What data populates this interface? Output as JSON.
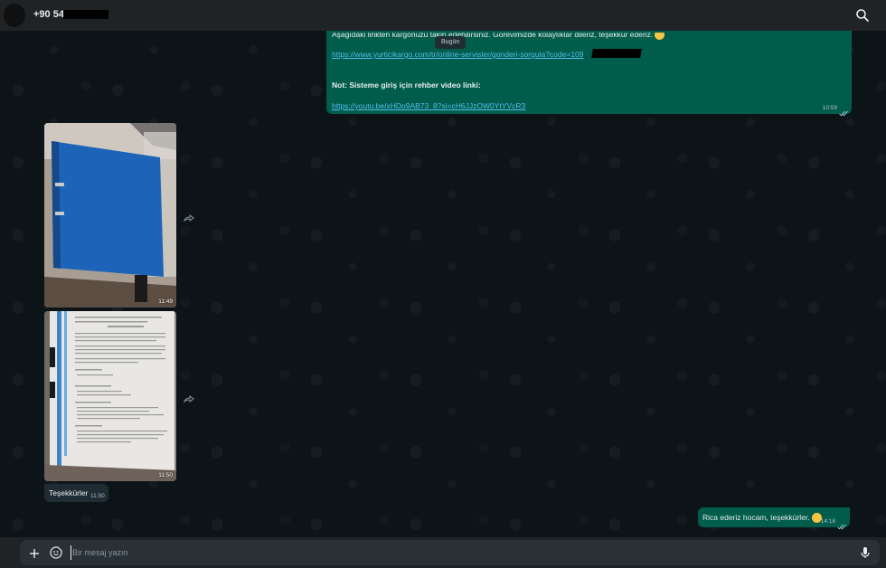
{
  "header": {
    "contact_name": "+90 54",
    "search_icon": "search-icon"
  },
  "date_separator": "Bugün",
  "messages": {
    "outgoing_1": {
      "line1": "Aşağıdaki linkten kargonuzu takip edebilirsiniz. Görevimizde kolaylıklar dileriz, teşekkür ederiz.",
      "link1": "https://www.yurticikargo.com/tr/online-servisler/gonderi-sorgula?code=109",
      "note": "Not: Sisteme giriş için rehber video linki:",
      "link2": "https://youtu.be/xHDo9AB73_8?si=cH6JJzOW0YtYVcR3",
      "time": "10:59"
    },
    "image_1": {
      "time": "11:49"
    },
    "image_2": {
      "time": "11:50"
    },
    "incoming_text": {
      "text": "Teşekkürler",
      "time": "11:50"
    },
    "outgoing_reply": {
      "text": "Rica ederiz hocam, teşekkürler.",
      "time": "14:18"
    }
  },
  "composer": {
    "placeholder": "Bir mesaj yazın",
    "icons": [
      "plus-icon",
      "sticker-icon",
      "microphone-icon"
    ]
  },
  "colors": {
    "outgoing_bubble": "#005c4b",
    "incoming_bubble": "#202c33",
    "link": "#53bdeb",
    "background": "#0d1418"
  }
}
